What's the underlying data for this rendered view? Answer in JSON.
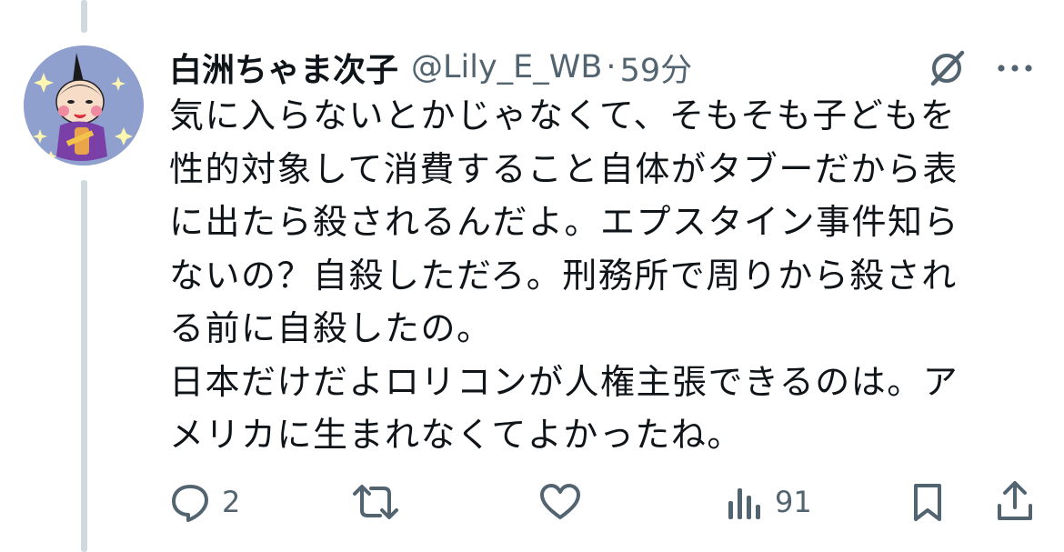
{
  "tweet": {
    "display_name": "白洲ちゃま次子",
    "handle": "@Lily_E_WB",
    "separator": "·",
    "time": "59分",
    "text_lines": [
      "気に入らないとかじゃなくて、そもそも子どもを",
      "性的対象して消費すること自体がタブーだから表",
      "に出たら殺されるんだよ。エプスタイン事件知ら",
      "ないの？自殺しただろ。刑務所で周りから殺され",
      "る前に自殺したの。",
      "日本だけだよロリコンが人権主張できるのは。ア",
      "メリカに生まれなくてよかったね。"
    ]
  },
  "actions": {
    "reply": {
      "icon": "reply-icon",
      "count": "2"
    },
    "retweet": {
      "icon": "retweet-icon",
      "count": ""
    },
    "like": {
      "icon": "heart-icon",
      "count": ""
    },
    "views": {
      "icon": "views-icon",
      "count": "91"
    },
    "bookmark": {
      "icon": "bookmark-icon",
      "count": ""
    },
    "share": {
      "icon": "share-icon",
      "count": ""
    }
  },
  "colors": {
    "text": "#0f1419",
    "secondary": "#536471",
    "thread_line": "#cfd9de",
    "avatar_bg": "#8fa0cf"
  }
}
